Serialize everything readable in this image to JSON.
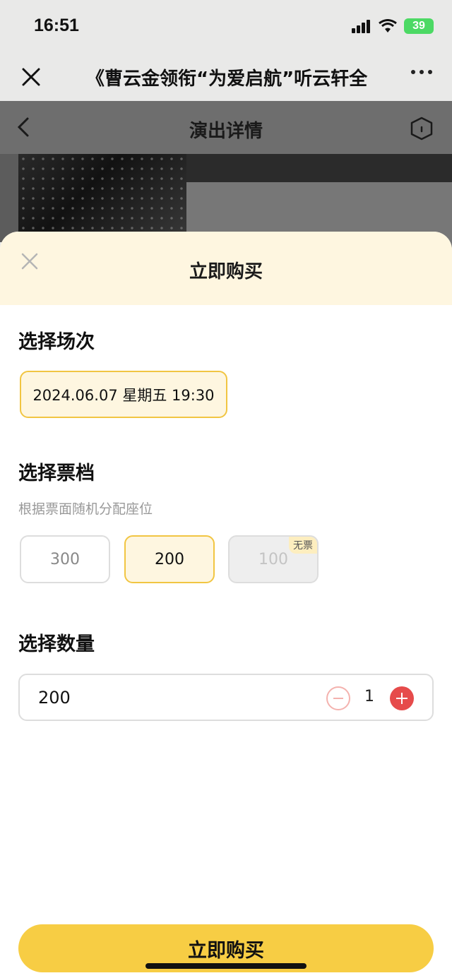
{
  "status_bar": {
    "time": "16:51",
    "battery": "39"
  },
  "wechat_header": {
    "title": "《曹云金领衔“为爱启航”听云轩全",
    "close_icon": "close-icon",
    "more_icon": "more-icon"
  },
  "page": {
    "title": "演出详情",
    "back_icon": "chevron-left-icon",
    "home_icon": "home-icon"
  },
  "sheet": {
    "title": "立即购买",
    "close_icon": "close-icon",
    "session": {
      "heading": "选择场次",
      "options": [
        {
          "label": "2024.06.07 星期五 19:30",
          "selected": true
        }
      ]
    },
    "tiers": {
      "heading": "选择票档",
      "hint": "根据票面随机分配座位",
      "options": [
        {
          "label": "300",
          "state": "normal"
        },
        {
          "label": "200",
          "state": "selected"
        },
        {
          "label": "100",
          "state": "disabled",
          "badge": "无票"
        }
      ]
    },
    "quantity": {
      "heading": "选择数量",
      "price": "200",
      "count": "1"
    },
    "buy_button": "立即购买"
  },
  "colors": {
    "accent": "#f7cd44",
    "selected_border": "#f1c542",
    "selected_bg": "#fef6e0",
    "plus_red": "#e64b4b"
  }
}
